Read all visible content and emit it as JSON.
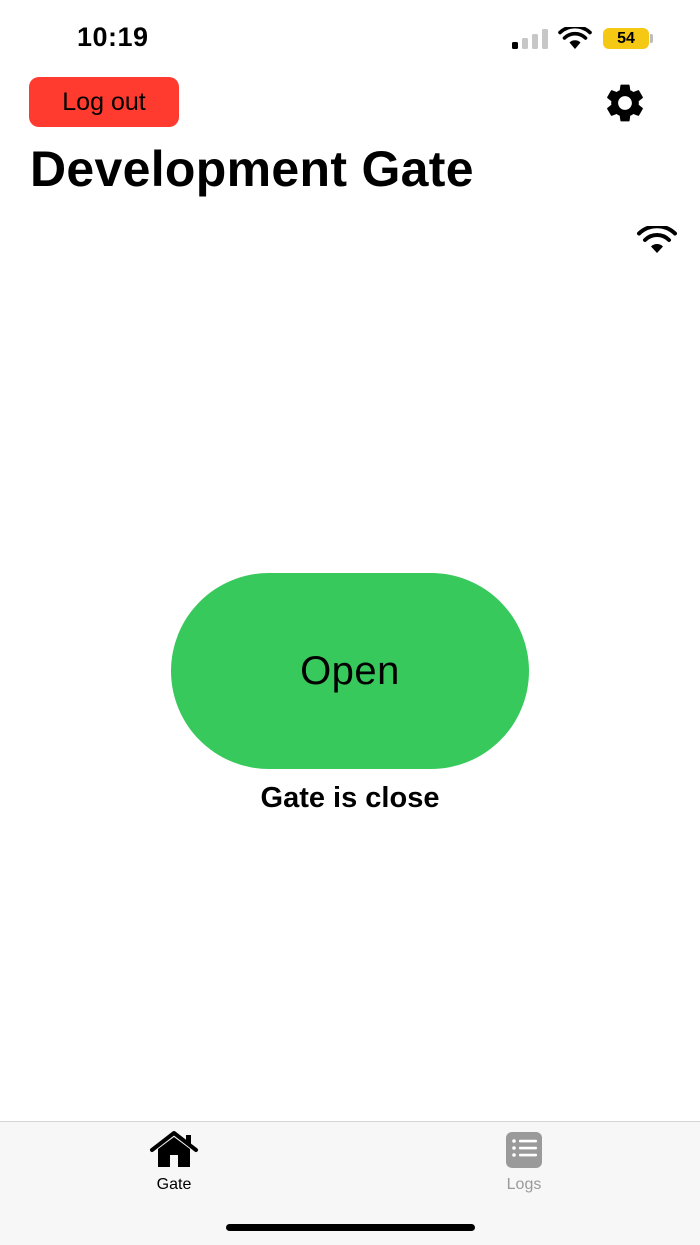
{
  "status_bar": {
    "time": "10:19",
    "battery": "54",
    "battery_color": "#f5c814"
  },
  "header": {
    "logout_label": "Log out",
    "logout_color": "#ff3b30",
    "settings_icon": "gear-icon",
    "title": "Development Gate",
    "connection_icon": "wifi-icon"
  },
  "main": {
    "open_label": "Open",
    "open_color": "#38c95c",
    "status_text": "Gate is close"
  },
  "tabs": [
    {
      "label": "Gate",
      "icon": "house-icon",
      "active": true
    },
    {
      "label": "Logs",
      "icon": "list-icon",
      "active": false
    }
  ]
}
